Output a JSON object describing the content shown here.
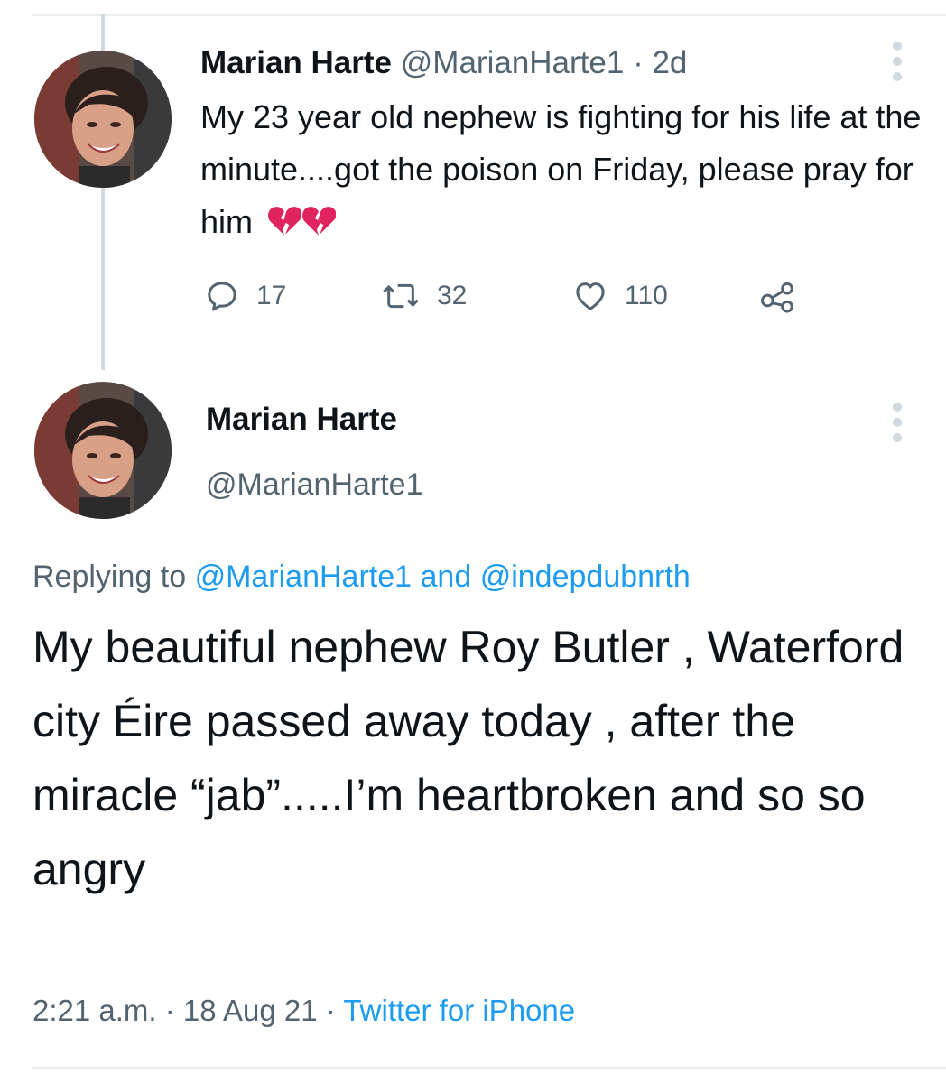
{
  "thread": {
    "parent_tweet": {
      "author_name": "Marian Harte",
      "handle": "@MarianHarte1",
      "separator": "·",
      "time_ago": "2d",
      "text": "My 23 year old nephew is fighting for his life at the minute....got the poison on Friday, please pray for him",
      "emoji": [
        "broken-heart",
        "broken-heart"
      ],
      "actions": {
        "reply_count": "17",
        "retweet_count": "32",
        "like_count": "110"
      }
    },
    "reply_tweet": {
      "author_name": "Marian Harte",
      "handle": "@MarianHarte1",
      "replying_prefix": "Replying to",
      "replying_to": [
        "@MarianHarte1",
        "@indepdubnrth"
      ],
      "replying_joiner": "and",
      "text": "My beautiful nephew Roy Butler , Waterford city Éire passed away today , after the miracle “jab”.....I’m heartbroken and so so angry",
      "time": "2:21 a.m.",
      "date": "18 Aug 21",
      "separator": "·",
      "source": "Twitter for iPhone"
    }
  },
  "colors": {
    "text_primary": "#0f1419",
    "text_secondary": "#536471",
    "link": "#1d9bf0",
    "thread_line": "#cfd9de",
    "broken_heart": "#e0245e"
  },
  "icons": [
    "more-options-icon",
    "reply-icon",
    "retweet-icon",
    "like-icon",
    "share-icon",
    "broken-heart-emoji"
  ]
}
